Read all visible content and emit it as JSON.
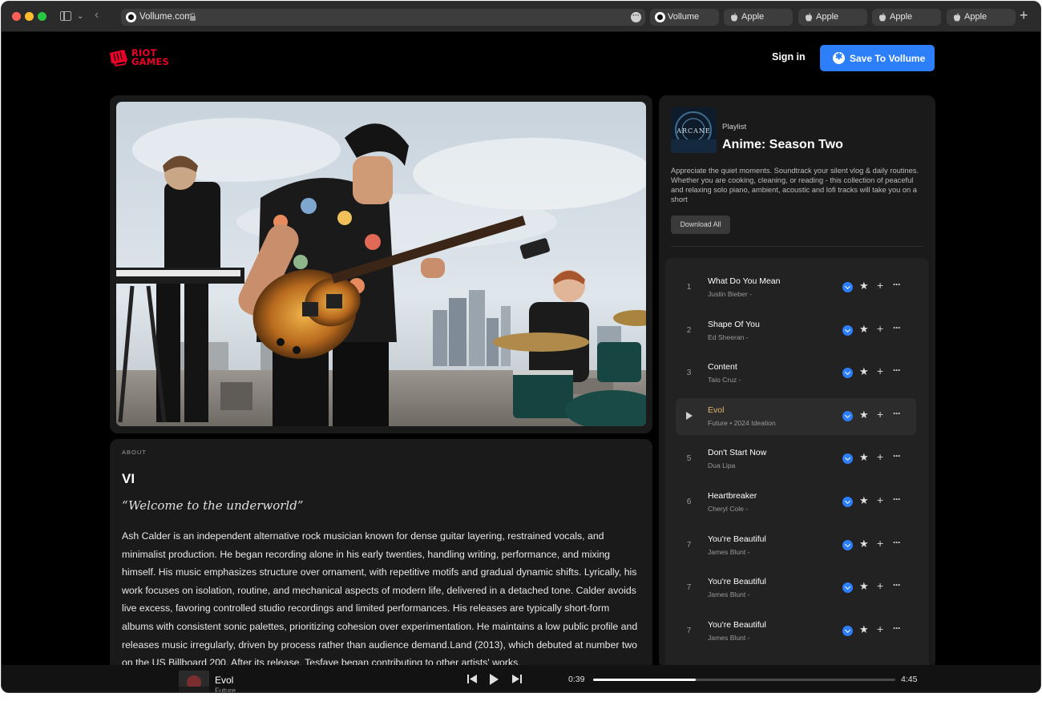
{
  "browser": {
    "url": "Vollume.com",
    "tabs": [
      {
        "label": "Vollume",
        "icon": "vollume-favicon"
      },
      {
        "label": "Apple",
        "icon": "apple-icon"
      },
      {
        "label": "Apple",
        "icon": "apple-icon"
      },
      {
        "label": "Apple",
        "icon": "apple-icon"
      },
      {
        "label": "Apple",
        "icon": "apple-icon"
      }
    ],
    "new_tab": "+"
  },
  "header": {
    "logo_line1": "RIOT",
    "logo_line2": "GAMES",
    "brand_color": "#eb0029",
    "signin_label": "Sign in",
    "save_label": "Save To Vollume",
    "accent_color": "#2d7ff9"
  },
  "about": {
    "kicker": "ABOUT",
    "name": "VI",
    "quote": "“Welcome to the underworld”",
    "bio": "Ash Calder is an independent alternative rock musician known for dense guitar layering, restrained vocals, and minimalist production. He began recording alone in his early twenties, handling writing, performance, and mixing himself. His music emphasizes structure over ornament, with repetitive motifs and gradual dynamic shifts. Lyrically, his work focuses on isolation, routine, and mechanical aspects of modern life, delivered in a detached tone. Calder avoids live excess, favoring controlled studio recordings and limited performances. His releases are typically short-form albums with consistent sonic palettes, prioritizing cohesion over experimentation. He maintains a low public profile and releases music irregularly, driven by process rather than audience demand.Land (2013), which debuted at number two on the US Billboard 200. After its release, Tesfaye began contributing to other artists' works."
  },
  "playlist": {
    "kicker": "Playlist",
    "cover_text": "ARCANE",
    "title": "Anime: Season Two",
    "description": "Appreciate the quiet moments. Soundtrack your silent vlog & daily routines. Whether you are cooking, cleaning, or reading - this collection of peaceful and relaxing solo piano, ambient, acoustic and lofi tracks will take you on a short",
    "download_all": "Download All",
    "tracks": [
      {
        "num": "1",
        "title": "What Do You Mean",
        "artist": "Justin Bieber -",
        "active": false
      },
      {
        "num": "2",
        "title": "Shape Of You",
        "artist": "Ed Sheeran -",
        "active": false
      },
      {
        "num": "3",
        "title": "Content",
        "artist": "Taio Cruz -",
        "active": false
      },
      {
        "num": "",
        "title": "Evol",
        "artist": "Future • 2024 Ideation",
        "active": true
      },
      {
        "num": "5",
        "title": "Don't Start Now",
        "artist": "Dua Lipa",
        "active": false
      },
      {
        "num": "6",
        "title": "Heartbreaker",
        "artist": "Cheryl Cole -",
        "active": false
      },
      {
        "num": "7",
        "title": "You're Beautiful",
        "artist": "James Blunt -",
        "active": false
      },
      {
        "num": "7",
        "title": "You're Beautiful",
        "artist": "James Blunt -",
        "active": false
      },
      {
        "num": "7",
        "title": "You're Beautiful",
        "artist": "James Blunt -",
        "active": false
      }
    ]
  },
  "player": {
    "title": "Evol",
    "artist": "Future",
    "elapsed": "0:39",
    "total": "4:45",
    "progress_fraction": 0.34
  }
}
